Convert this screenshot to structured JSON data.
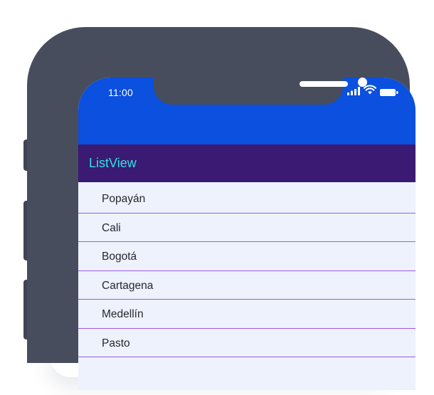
{
  "status_bar": {
    "time": "11:00",
    "icons": [
      "signal-icon",
      "wifi-icon",
      "battery-icon"
    ]
  },
  "app_bar": {
    "title": "ListView"
  },
  "list": {
    "items": [
      {
        "label": "Popayán"
      },
      {
        "label": "Cali"
      },
      {
        "label": "Bogotá"
      },
      {
        "label": "Cartagena"
      },
      {
        "label": "Medellín"
      },
      {
        "label": "Pasto"
      }
    ]
  },
  "colors": {
    "phone_frame": "#484d5e",
    "status_bar": "#0b50de",
    "app_bar": "#3a1a73",
    "title_text": "#31e3e3",
    "list_background": "#edf2fc",
    "divider": "#9b5be6",
    "item_text": "#27272f"
  }
}
